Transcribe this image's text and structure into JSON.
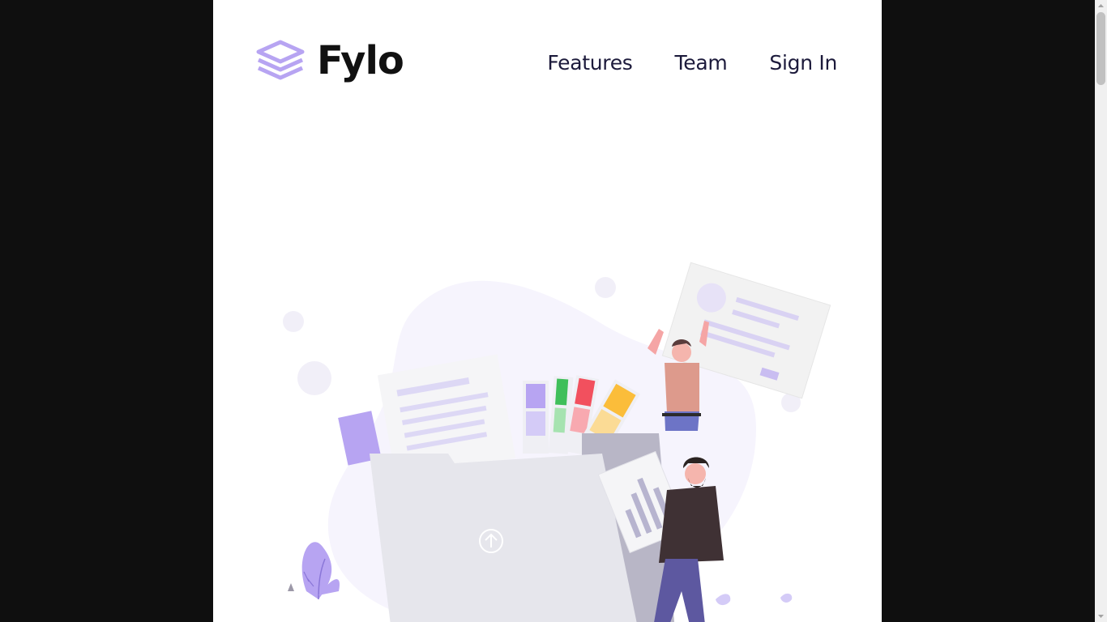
{
  "brand": {
    "name": "Fylo",
    "accent": "#b7a4f2"
  },
  "nav": {
    "items": [
      {
        "label": "Features",
        "name": "nav-features-link"
      },
      {
        "label": "Team",
        "name": "nav-team-link"
      },
      {
        "label": "Sign In",
        "name": "nav-signin-link"
      }
    ]
  },
  "hero": {
    "illustration": "file-upload-illustration"
  },
  "colors": {
    "page_background": "#ffffff",
    "outer_background": "#0f0f0f",
    "nav_text": "#1c1a3b",
    "illustration_primary": "#b7a4f2"
  }
}
